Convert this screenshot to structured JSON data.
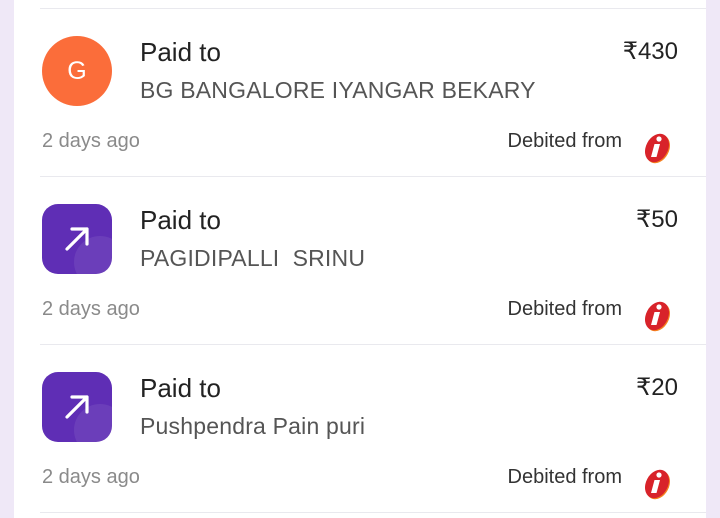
{
  "transactions": [
    {
      "avatar_type": "letter",
      "avatar_letter": "G",
      "avatar_color": "#fb6d3a",
      "title": "Paid to",
      "payee": "BG BANGALORE IYANGAR BEKARY",
      "amount": "₹430",
      "time": "2 days ago",
      "debited_label": "Debited from",
      "bank_icon": "icici-bank-icon"
    },
    {
      "avatar_type": "arrow",
      "avatar_icon": "arrow-up-right-icon",
      "avatar_color": "#5f2eb5",
      "title": "Paid to",
      "payee": "PAGIDIPALLI  SRINU",
      "amount": "₹50",
      "time": "2 days ago",
      "debited_label": "Debited from",
      "bank_icon": "icici-bank-icon"
    },
    {
      "avatar_type": "arrow",
      "avatar_icon": "arrow-up-right-icon",
      "avatar_color": "#5f2eb5",
      "title": "Paid to",
      "payee": "Pushpendra Pain puri",
      "amount": "₹20",
      "time": "2 days ago",
      "debited_label": "Debited from",
      "bank_icon": "icici-bank-icon"
    }
  ],
  "colors": {
    "page_background": "#efe8f7",
    "card_background": "#ffffff",
    "bank_red": "#d8232a",
    "bank_orange": "#f58220"
  }
}
